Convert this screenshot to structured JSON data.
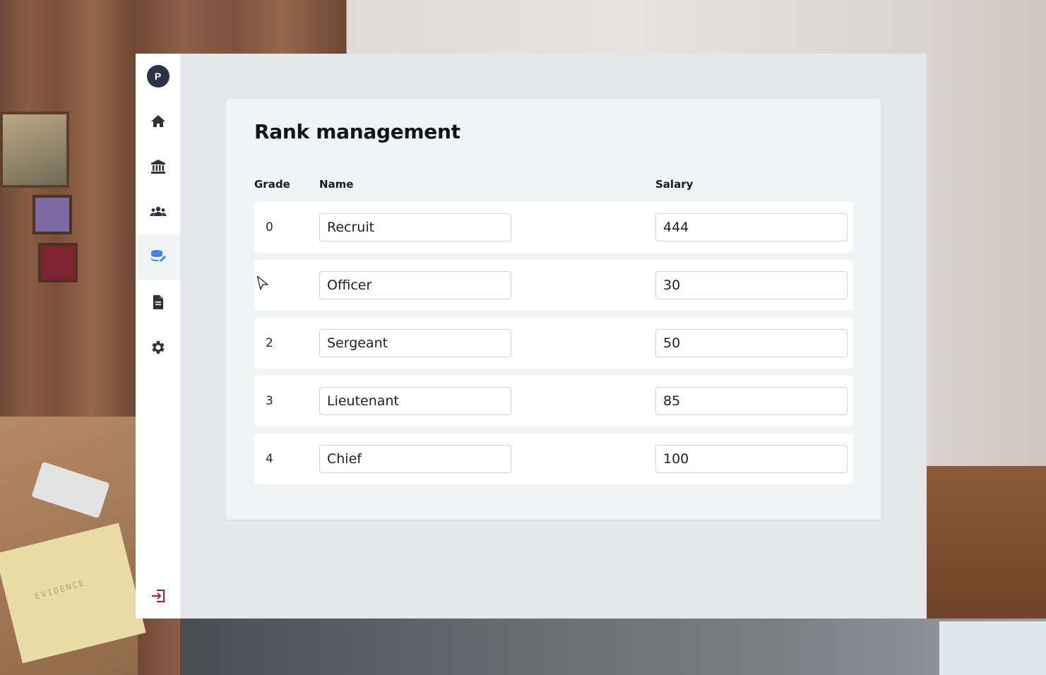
{
  "sidebar": {
    "avatar_initial": "P",
    "items": [
      {
        "icon": "home-icon"
      },
      {
        "icon": "bank-icon"
      },
      {
        "icon": "users-icon"
      },
      {
        "icon": "database-edit-icon",
        "active": true
      },
      {
        "icon": "document-icon"
      },
      {
        "icon": "gear-icon"
      }
    ],
    "logout_icon": "logout-icon"
  },
  "page": {
    "title": "Rank management",
    "headers": {
      "grade": "Grade",
      "name": "Name",
      "salary": "Salary"
    }
  },
  "ranks": [
    {
      "grade": "0",
      "name": "Recruit",
      "salary": "444"
    },
    {
      "grade": "",
      "name": "Officer",
      "salary": "30"
    },
    {
      "grade": "2",
      "name": "Sergeant",
      "salary": "50"
    },
    {
      "grade": "3",
      "name": "Lieutenant",
      "salary": "85"
    },
    {
      "grade": "4",
      "name": "Chief",
      "salary": "100"
    }
  ],
  "background": {
    "paper_text": "EVIDENCE"
  },
  "colors": {
    "accent": "#3b82f6",
    "icon": "#2b3442",
    "logout": "#b91c1c"
  }
}
